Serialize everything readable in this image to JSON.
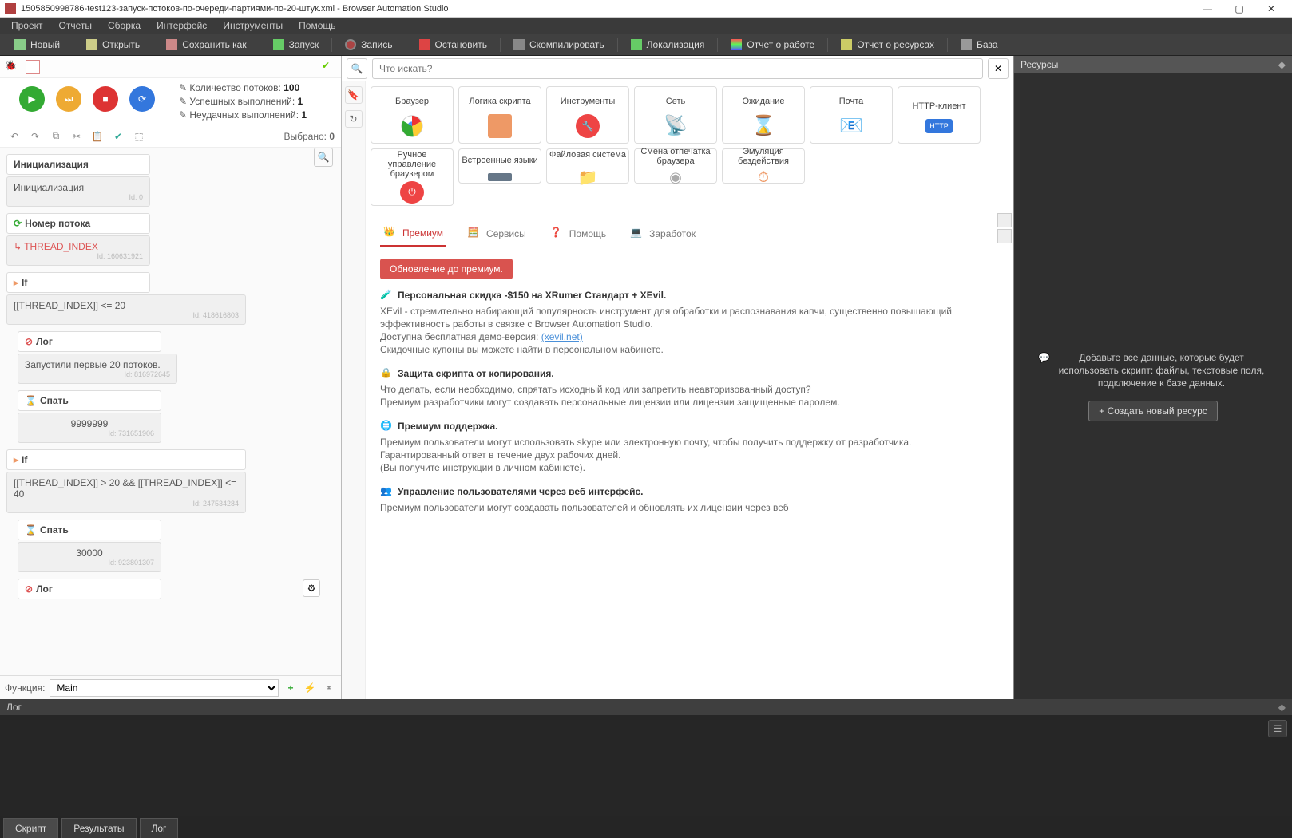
{
  "title": "1505850998786-test123-запуск-потоков-по-очереди-партиями-по-20-штук.xml - Browser Automation Studio",
  "menubar": [
    "Проект",
    "Отчеты",
    "Сборка",
    "Интерфейс",
    "Инструменты",
    "Помощь"
  ],
  "toolbar": {
    "new": "Новый",
    "open": "Открыть",
    "saveas": "Сохранить как",
    "run": "Запуск",
    "record": "Запись",
    "stop": "Остановить",
    "compile": "Скомпилировать",
    "localize": "Локализация",
    "report_work": "Отчет о работе",
    "report_res": "Отчет о ресурсах",
    "db": "База"
  },
  "stats": {
    "threads_label": "Количество потоков:",
    "threads_val": "100",
    "success_label": "Успешных выполнений:",
    "success_val": "1",
    "fail_label": "Неудачных выполнений:",
    "fail_val": "1",
    "selected_label": "Выбрано:",
    "selected_val": "0"
  },
  "func": {
    "label": "Функция:",
    "value": "Main"
  },
  "blocks": {
    "b1": {
      "h": "Инициализация",
      "c": "Инициализация",
      "id": "Id: 0"
    },
    "b2": {
      "h": "Номер потока",
      "c": "↳ THREAD_INDEX",
      "id": "Id: 160631921"
    },
    "b3": {
      "h": "If",
      "c": "[[THREAD_INDEX]] <= 20",
      "id": "Id: 418616803"
    },
    "b4": {
      "h": "Лог",
      "c": "Запустили первые 20 потоков.",
      "id": "Id: 816972645"
    },
    "b5": {
      "h": "Спать",
      "c": "9999999",
      "id": "Id: 731651906"
    },
    "b6": {
      "h": "If",
      "c": "[[THREAD_INDEX]] > 20 && [[THREAD_INDEX]] <= 40",
      "id": "Id: 247534284"
    },
    "b7": {
      "h": "Спать",
      "c": "30000",
      "id": "Id: 923801307"
    },
    "b8": {
      "h": "Лог"
    }
  },
  "search": {
    "placeholder": "Что искать?",
    "clear": "✕"
  },
  "tiles": [
    {
      "label": "Браузер"
    },
    {
      "label": "Логика скрипта"
    },
    {
      "label": "Инструменты"
    },
    {
      "label": "Сеть"
    },
    {
      "label": "Ожидание"
    },
    {
      "label": "Почта"
    },
    {
      "label": "HTTP-клиент"
    },
    {
      "label": "Ручное управление браузером"
    },
    {
      "label": "Встроенные языки"
    },
    {
      "label": "Файловая система"
    },
    {
      "label": "Смена отпечатка браузера"
    },
    {
      "label": "Эмуляция бездействия"
    }
  ],
  "ptabs": {
    "premium": "Премиум",
    "services": "Сервисы",
    "help": "Помощь",
    "earn": "Заработок"
  },
  "premium": {
    "upgrade": "Обновление до премиум.",
    "s1_h": "Персональная скидка -$150 на XRumer Стандарт + XEvil.",
    "s1_p1": "XEvil - стремительно набирающий популярность инструмент для обработки и распознавания капчи, существенно повышающий эффективность работы в связке с Browser Automation Studio.",
    "s1_p2": "Доступна бесплатная демо-версия: ",
    "s1_link": "(xevil.net)",
    "s1_p3": "Скидочные купоны вы можете найти в персональном кабинете.",
    "s2_h": "Защита скрипта от копирования.",
    "s2_p1": "Что делать, если необходимо, спрятать исходный код или запретить неавторизованный доступ?",
    "s2_p2": "Премиум разработчики могут создавать персональные лицензии или лицензии защищенные паролем.",
    "s3_h": "Премиум поддержка.",
    "s3_p1": "Премиум пользователи могут использовать skype или электронную почту, чтобы получить поддержку от разработчика.",
    "s3_p2": "Гарантированный ответ в течение двух рабочих дней.",
    "s3_p3": "(Вы получите инструкции в личном кабинете).",
    "s4_h": "Управление пользователями через веб интерфейс.",
    "s4_p1": "Премиум пользователи могут создавать пользователей и обновлять их лицензии через веб"
  },
  "resources": {
    "title": "Ресурсы",
    "msg": "Добавьте все данные, которые будет использовать скрипт: файлы, текстовые поля, подключение к базе данных.",
    "create": "+ Создать новый ресурс"
  },
  "log": {
    "title": "Лог"
  },
  "bottabs": {
    "script": "Скрипт",
    "results": "Результаты",
    "log": "Лог"
  }
}
